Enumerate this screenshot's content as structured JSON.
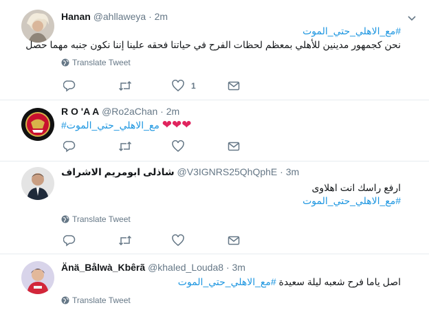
{
  "colors": {
    "link": "#1b95e0",
    "muted": "#657786",
    "heart": "#e0245e",
    "divider": "#e6ecf0"
  },
  "icons": [
    "globe-icon",
    "reply-icon",
    "retweet-icon",
    "like-icon",
    "dm-icon",
    "caret-down-icon"
  ],
  "tweets": [
    {
      "name": "Hanan",
      "handle": "@ahllaweya",
      "dot": "·",
      "time": "2m",
      "hashtag": "#مع_الاهلي_حتي_الموت",
      "text": "نحن كجمهور مدينين للأهلي بمعظم لحظات الفرح في حياتنا فحقه علينا إننا نكون جنبه مهما حصل",
      "translate": "Translate Tweet",
      "likes": "1"
    },
    {
      "name": "R O 'A A",
      "handle": "@Ro2aChan",
      "dot": "·",
      "time": "2m",
      "hearts": "❤❤❤",
      "hashtag": "#مع_الاهلي_حتي_الموت"
    },
    {
      "name": "شاذلى ابومريم الاشراف",
      "handle": "@V3IGNRS25QhQphE",
      "dot": "·",
      "time": "3m",
      "text": "ارفع راسك انت اهلاوى",
      "hashtag": "#مع_الاهلي_حتي_الموت",
      "translate": "Translate Tweet"
    },
    {
      "name": "Änä_Bålwà_Kbêrã",
      "handle": "@khaled_Louda8",
      "dot": "·",
      "time": "3m",
      "text": "اصل ياما فرح شعبه ليلة سعيدة",
      "hashtag": "#مع_الاهلي_حتي_الموت",
      "translate": "Translate Tweet"
    }
  ]
}
